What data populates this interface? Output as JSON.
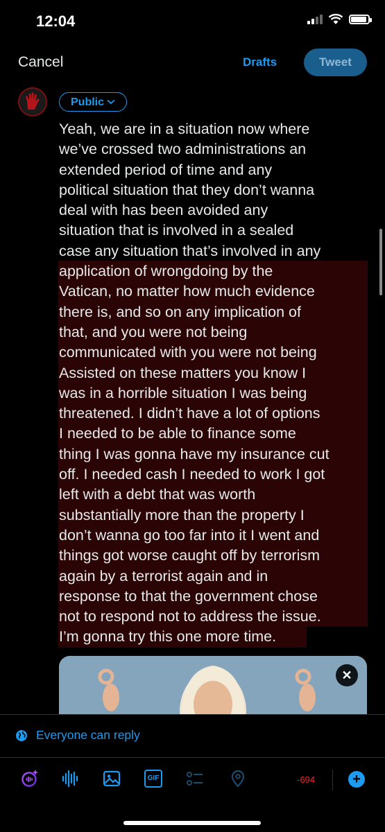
{
  "status_bar": {
    "time": "12:04"
  },
  "header": {
    "cancel_label": "Cancel",
    "drafts_label": "Drafts",
    "tweet_label": "Tweet"
  },
  "composer": {
    "audience_label": "Public",
    "text_lines": [
      "Yeah, we are in a situation now where",
      "we’ve crossed two administrations an",
      "extended period of time and any",
      "political situation that they don’t wanna",
      "deal with has been avoided any",
      "situation that is involved in a sealed",
      "case any situation that’s involved in any",
      "application of wrongdoing by the",
      "Vatican, no matter how much evidence",
      "there is, and so on any implication of",
      "that, and you were not being",
      "communicated with you were not being",
      "Assisted on these matters you know I",
      "was in a horrible situation I was being",
      "threatened. I didn’t have a lot of options",
      "I needed to be able to finance some",
      "thing I was gonna have my insurance cut",
      "off. I needed cash I needed to work I got",
      "left with a debt that was worth",
      "substantially more than the property I",
      "don’t wanna go too far into it I went and",
      "things got worse caught off by terrorism",
      "again by a terrorist again and in",
      "response to that the government chose",
      "not to respond not to address the issue.",
      "I’m gonna try this one more time."
    ],
    "highlight_color": "#2b0505"
  },
  "reply_setting": {
    "label": "Everyone can reply"
  },
  "toolbar": {
    "icons": [
      "spaces-icon",
      "voice-icon",
      "image-icon",
      "gif-icon",
      "poll-icon",
      "location-icon"
    ],
    "gif_label": "GIF",
    "char_counter": "-694"
  },
  "colors": {
    "accent": "#1d9bf0",
    "over_limit": "#f4212e",
    "background": "#000000"
  }
}
